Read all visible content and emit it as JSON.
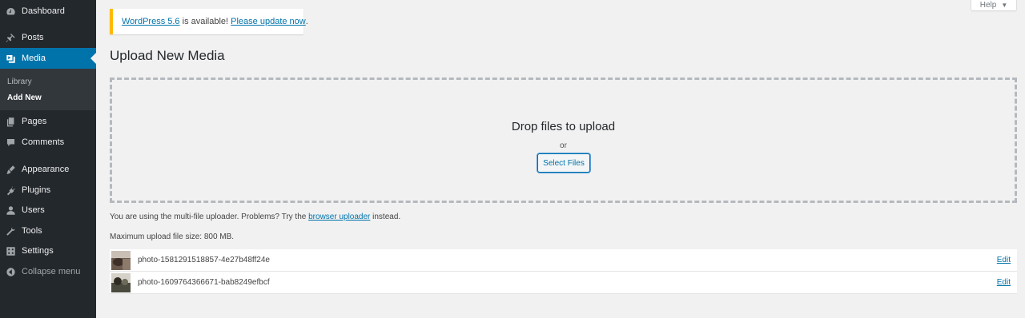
{
  "sidebar": {
    "items": [
      {
        "label": "Dashboard",
        "icon": "dashboard-icon"
      },
      {
        "label": "Posts",
        "icon": "pushpin-icon"
      },
      {
        "label": "Media",
        "icon": "media-icon"
      },
      {
        "label": "Pages",
        "icon": "pages-icon"
      },
      {
        "label": "Comments",
        "icon": "comment-icon"
      },
      {
        "label": "Appearance",
        "icon": "brush-icon"
      },
      {
        "label": "Plugins",
        "icon": "plug-icon"
      },
      {
        "label": "Users",
        "icon": "user-icon"
      },
      {
        "label": "Tools",
        "icon": "wrench-icon"
      },
      {
        "label": "Settings",
        "icon": "settings-icon"
      }
    ],
    "submenu": [
      {
        "label": "Library"
      },
      {
        "label": "Add New"
      }
    ],
    "collapse_label": "Collapse menu",
    "active_color": "#0073aa",
    "background_color": "#23282d"
  },
  "help": {
    "label": "Help",
    "caret": "▼"
  },
  "notice": {
    "version_link": "WordPress 5.6",
    "middle_text": " is available! ",
    "update_link": "Please update now",
    "end_text": ".",
    "border_color": "#ffb900"
  },
  "page_title": "Upload New Media",
  "uploader": {
    "drop_text": "Drop files to upload",
    "or_text": "or",
    "select_button": "Select Files"
  },
  "multi_file_note": {
    "prefix": "You are using the multi-file uploader. Problems? Try the ",
    "link": "browser uploader",
    "suffix": " instead."
  },
  "max_size_text": "Maximum upload file size: 800 MB.",
  "media_items": [
    {
      "filename": "photo-1581291518857-4e27b48ff24e",
      "edit_label": "Edit"
    },
    {
      "filename": "photo-1609764366671-bab8249efbcf",
      "edit_label": "Edit"
    }
  ]
}
